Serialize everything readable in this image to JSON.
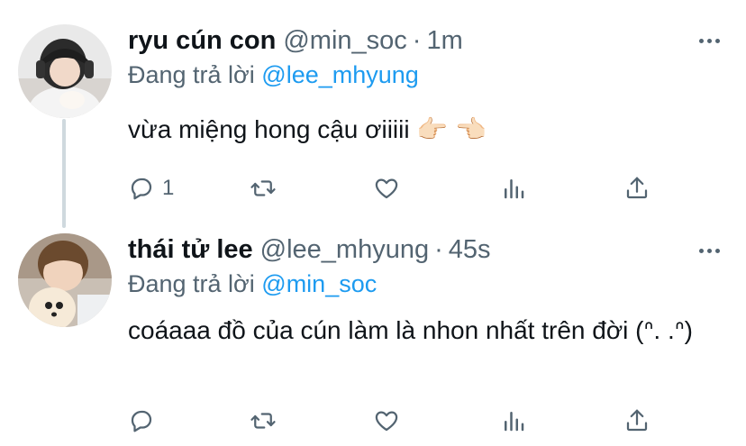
{
  "tweets": [
    {
      "name": "ryu cún con",
      "handle": "@min_soc",
      "separator": "·",
      "time": "1m",
      "reply_prefix": "Đang trả lời",
      "reply_to": "@lee_mhyung",
      "text": "vừa miệng hong cậu ơiiiii 👉🏻 👈🏻",
      "reply_count": "1",
      "retweet_count": "",
      "like_count": ""
    },
    {
      "name": "thái tử lee",
      "handle": "@lee_mhyung",
      "separator": "·",
      "time": "45s",
      "reply_prefix": "Đang trả lời",
      "reply_to": "@min_soc",
      "text": "coáaaa đồ của cún làm là nhon nhất trên đời (ᐢ. .ᐢ)",
      "reply_count": "",
      "retweet_count": "",
      "like_count": ""
    }
  ],
  "colors": {
    "text": "#0f1419",
    "secondary": "#536471",
    "link": "#1d9bf0",
    "thread": "#cfd9de"
  },
  "icons": [
    "reply-icon",
    "retweet-icon",
    "like-icon",
    "stats-icon",
    "share-icon",
    "more-icon"
  ]
}
